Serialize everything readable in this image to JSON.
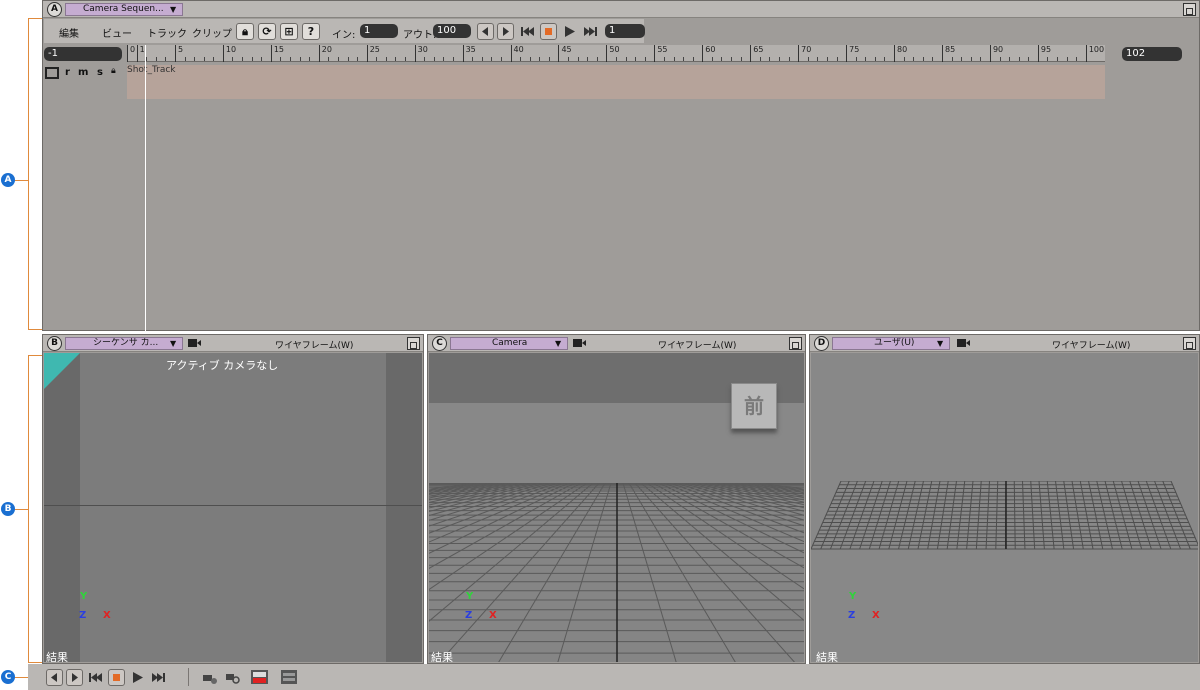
{
  "callouts": [
    "A",
    "B",
    "C"
  ],
  "panel_a": {
    "letter": "A",
    "dropdown": "Camera Sequen...",
    "menus": [
      "編集",
      "ビュー",
      "トラック",
      "クリップ"
    ],
    "tool_icons": [
      "lock-icon",
      "refresh-icon",
      "snap-icon",
      "help-icon"
    ],
    "in_label": "イン:",
    "in_value": "1",
    "out_label": "アウト:",
    "out_value": "100",
    "frame_value": "1",
    "start_field": "-1",
    "end_field": "102",
    "ruler_ticks": [
      "0",
      "1",
      "5",
      "10",
      "15",
      "20",
      "25",
      "30",
      "35",
      "40",
      "45",
      "50",
      "55",
      "60",
      "65",
      "70",
      "75",
      "80",
      "85",
      "90",
      "95",
      "100"
    ],
    "track_flags": [
      "r",
      "m",
      "s"
    ],
    "track_name": "Shot_Track"
  },
  "panel_b": {
    "letter": "B",
    "dropdown": "シーケンサ カ...",
    "mode": "ワイヤフレーム(W)",
    "message": "アクティブ カメラなし",
    "result": "結果"
  },
  "panel_c": {
    "letter": "C",
    "dropdown": "Camera",
    "mode": "ワイヤフレーム(W)",
    "view_cube_label": "前",
    "result": "結果"
  },
  "panel_d": {
    "letter": "D",
    "dropdown": "ユーザ(U)",
    "mode": "ワイヤフレーム(W)",
    "result": "結果"
  },
  "axes": {
    "y": "Y",
    "z": "Z",
    "x": "X"
  },
  "colors": {
    "dropdown": "#c5acd1",
    "track_bar": "#b6a39a",
    "callout": "#1a6fd1",
    "bracket": "#e08a3c"
  }
}
